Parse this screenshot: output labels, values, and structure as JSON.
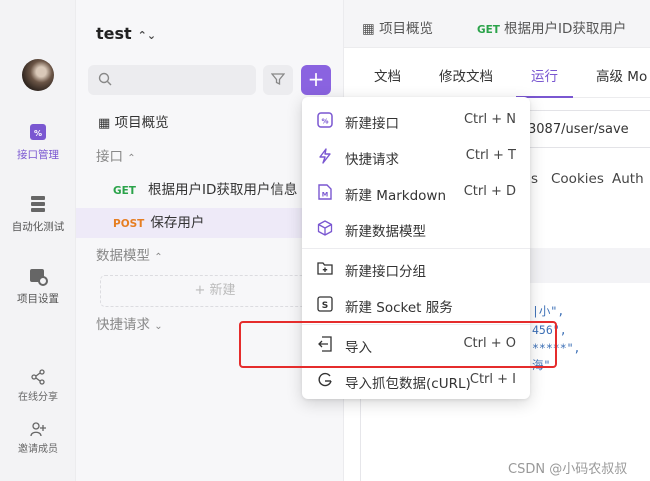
{
  "rail": {
    "items": [
      {
        "label": "接口管理"
      },
      {
        "label": "自动化测试"
      },
      {
        "label": "项目设置"
      },
      {
        "label": "在线分享"
      },
      {
        "label": "邀请成员"
      }
    ]
  },
  "sidebar": {
    "project_name": "test",
    "overview": "项目概览",
    "api_section": "接口",
    "apis": [
      {
        "method": "GET",
        "name": "根据用户ID获取用户信息"
      },
      {
        "method": "POST",
        "name": "保存用户"
      }
    ],
    "models_section": "数据模型",
    "new_label": "+ 新建",
    "quick_section": "快捷请求"
  },
  "main": {
    "top_tabs": [
      {
        "label": "项目概览"
      },
      {
        "method": "GET",
        "label": "根据用户ID获取用户"
      }
    ],
    "sub_tabs": [
      "文档",
      "修改文档",
      "运行",
      "高级 Mo"
    ],
    "url_fragment": "3087/user/save",
    "param_tabs": [
      "s",
      "Cookies",
      "Auth"
    ],
    "code_lines": [
      "|小\",",
      "456\",",
      "*****\",",
      "海\""
    ]
  },
  "menu": {
    "items": [
      {
        "icon": "api-icon",
        "label": "新建接口",
        "shortcut": "Ctrl + N"
      },
      {
        "icon": "lightning-icon",
        "label": "快捷请求",
        "shortcut": "Ctrl + T"
      },
      {
        "icon": "markdown-icon",
        "label": "新建 Markdown",
        "shortcut": "Ctrl + D"
      },
      {
        "icon": "cube-icon",
        "label": "新建数据模型",
        "shortcut": ""
      },
      {
        "icon": "folder-plus-icon",
        "label": "新建接口分组",
        "shortcut": ""
      },
      {
        "icon": "socket-icon",
        "label": "新建 Socket 服务",
        "shortcut": ""
      },
      {
        "icon": "import-icon",
        "label": "导入",
        "shortcut": "Ctrl + O"
      },
      {
        "icon": "curl-icon",
        "label": "导入抓包数据(cURL)",
        "shortcut": "Ctrl + I"
      }
    ]
  },
  "watermark": "CSDN @小码农叔叔",
  "colors": {
    "accent": "#8a63e0",
    "get": "#2ba34a",
    "post": "#e67e22",
    "highlight": "#e52c2c"
  }
}
